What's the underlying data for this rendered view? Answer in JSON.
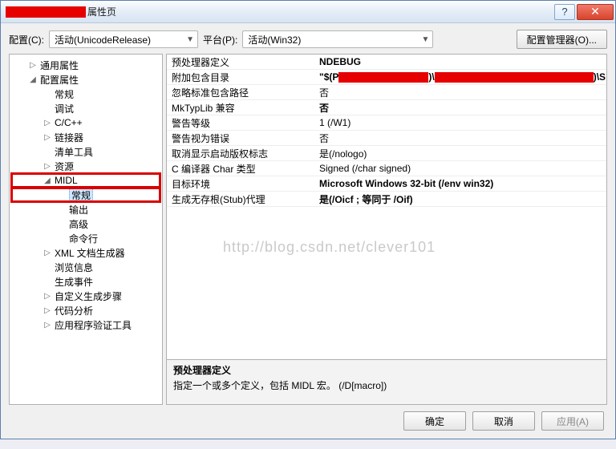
{
  "title_suffix": "属性页",
  "labels": {
    "config": "配置(C):",
    "platform": "平台(P):",
    "config_manager": "配置管理器(O)...",
    "ok": "确定",
    "cancel": "取消",
    "apply": "应用(A)"
  },
  "combos": {
    "config_value": "活动(UnicodeRelease)",
    "platform_value": "活动(Win32)"
  },
  "tree": [
    {
      "lvl": 1,
      "tw": "▷",
      "label": "通用属性"
    },
    {
      "lvl": 1,
      "tw": "◢",
      "label": "配置属性"
    },
    {
      "lvl": 2,
      "tw": "",
      "label": "常规"
    },
    {
      "lvl": 2,
      "tw": "",
      "label": "调试"
    },
    {
      "lvl": 2,
      "tw": "▷",
      "label": "C/C++"
    },
    {
      "lvl": 2,
      "tw": "▷",
      "label": "链接器"
    },
    {
      "lvl": 2,
      "tw": "",
      "label": "清单工具"
    },
    {
      "lvl": 2,
      "tw": "▷",
      "label": "资源"
    },
    {
      "lvl": 2,
      "tw": "◢",
      "label": "MIDL",
      "hl": true
    },
    {
      "lvl": 3,
      "tw": "",
      "label": "常规",
      "hl": true,
      "sel": true
    },
    {
      "lvl": 3,
      "tw": "",
      "label": "输出"
    },
    {
      "lvl": 3,
      "tw": "",
      "label": "高级"
    },
    {
      "lvl": 3,
      "tw": "",
      "label": "命令行"
    },
    {
      "lvl": 2,
      "tw": "▷",
      "label": "XML 文档生成器"
    },
    {
      "lvl": 2,
      "tw": "",
      "label": "浏览信息"
    },
    {
      "lvl": 2,
      "tw": "",
      "label": "生成事件"
    },
    {
      "lvl": 2,
      "tw": "▷",
      "label": "自定义生成步骤"
    },
    {
      "lvl": 2,
      "tw": "▷",
      "label": "代码分析"
    },
    {
      "lvl": 2,
      "tw": "▷",
      "label": "应用程序验证工具"
    }
  ],
  "grid": [
    {
      "k": "预处理器定义",
      "v": "NDEBUG",
      "bold": true
    },
    {
      "k": "附加包含目录",
      "v_prefix": "\"$(P",
      "v_suffix": ")\\S",
      "bold": true,
      "redact": true
    },
    {
      "k": "忽略标准包含路径",
      "v": "否"
    },
    {
      "k": "MkTypLib 兼容",
      "v": "否",
      "bold": true
    },
    {
      "k": "警告等级",
      "v": "1 (/W1)"
    },
    {
      "k": "警告视为错误",
      "v": "否"
    },
    {
      "k": "取消显示启动版权标志",
      "v": "是(/nologo)"
    },
    {
      "k": "C 编译器 Char 类型",
      "v": "Signed (/char signed)"
    },
    {
      "k": "目标环境",
      "v": "Microsoft Windows 32-bit (/env win32)",
      "bold": true
    },
    {
      "k": "生成无存根(Stub)代理",
      "v": "是(/Oicf ; 等同于 /Oif)",
      "bold": true
    }
  ],
  "watermark": "http://blog.csdn.net/clever101",
  "desc": {
    "title": "预处理器定义",
    "text": "指定一个或多个定义，包括 MIDL 宏。     (/D[macro])"
  }
}
